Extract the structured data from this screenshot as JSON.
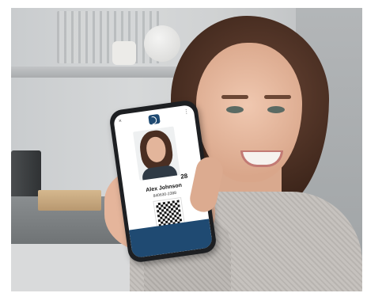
{
  "scene": {
    "background": "kitchen",
    "subject": "woman holding phone showing a digital ID"
  },
  "phone_screen": {
    "close_icon": "×",
    "menu_icon": "⋮",
    "logo_icon": "id-logo-icon",
    "age_badge": "28",
    "name": "Alex Johnson",
    "id_number": "840630-2388",
    "footer_text": "",
    "colors": {
      "brand": "#1f4a72"
    }
  }
}
